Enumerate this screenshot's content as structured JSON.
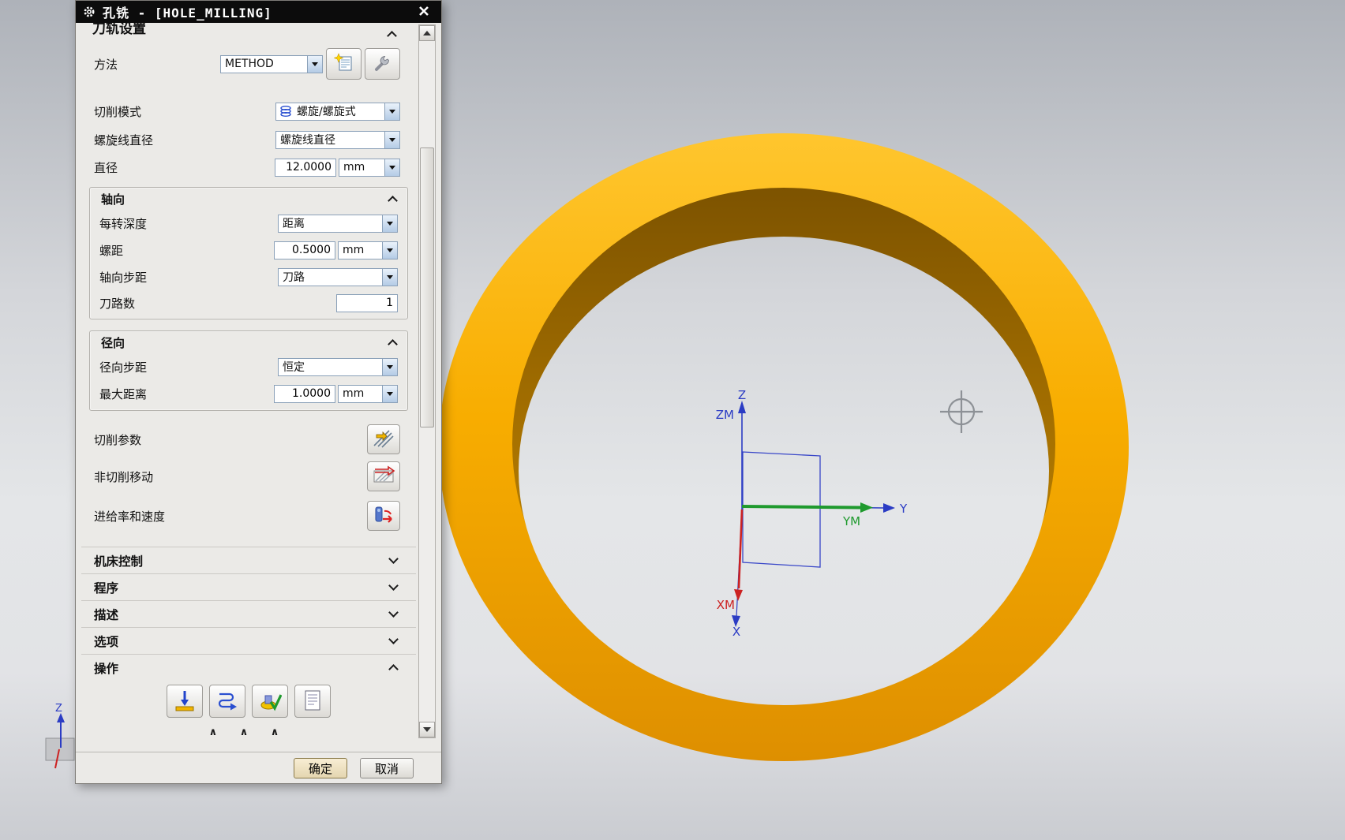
{
  "titlebar": {
    "title": "孔铣 - [HOLE_MILLING]"
  },
  "toolpath": {
    "header": "刀轨设置",
    "method": {
      "label": "方法",
      "value": "METHOD"
    },
    "cut_pattern": {
      "label": "切削模式",
      "value": "螺旋/螺旋式"
    },
    "helix_diameter": {
      "label": "螺旋线直径",
      "value": "螺旋线直径"
    },
    "diameter": {
      "label": "直径",
      "value": "12.0000",
      "unit": "mm"
    }
  },
  "axial": {
    "header": "轴向",
    "depth_per_rev": {
      "label": "每转深度",
      "value": "距离"
    },
    "pitch": {
      "label": "螺距",
      "value": "0.5000",
      "unit": "mm"
    },
    "axial_stepover": {
      "label": "轴向步距",
      "value": "刀路"
    },
    "pass_count": {
      "label": "刀路数",
      "value": "1"
    }
  },
  "radial": {
    "header": "径向",
    "radial_stepover": {
      "label": "径向步距",
      "value": "恒定"
    },
    "max_distance": {
      "label": "最大距离",
      "value": "1.0000",
      "unit": "mm"
    }
  },
  "action_rows": {
    "cutting_params": "切削参数",
    "non_cutting_moves": "非切削移动",
    "feeds_speeds": "进给率和速度"
  },
  "sections": {
    "machine_control": "机床控制",
    "program": "程序",
    "description": "描述",
    "options": "选项",
    "operation": "操作"
  },
  "footer": {
    "ok": "确定",
    "cancel": "取消",
    "collapse_marks": "∧ ∧ ∧"
  },
  "icons": {
    "titlebar_left": "gear-icon",
    "close": "close-icon",
    "method_buttons": [
      "edit-method-icon",
      "wrench-icon"
    ],
    "cut_pattern_field": "coil-icon",
    "cutting_params": "cutting-params-icon",
    "non_cutting_moves": "non-cutting-moves-icon",
    "feeds_speeds": "feeds-speeds-icon",
    "operation": [
      "generate-toolpath-icon",
      "replay-icon",
      "verify-icon",
      "list-icon"
    ]
  },
  "viewport": {
    "labels": {
      "z": "Z",
      "zm": "ZM",
      "y": "Y",
      "ym": "YM",
      "x": "X",
      "xm": "XM",
      "triad_z": "Z"
    },
    "colors": {
      "ring_top": "#FFC62E",
      "ring_mid": "#F8AD00",
      "ring_bottom": "#DE8F00",
      "ring_wall_dark": "#7D5300",
      "ring_wall_light": "#D29300",
      "axis_blue": "#2B3CC4",
      "axis_green": "#1F9A2E",
      "axis_red": "#CC2222"
    }
  }
}
